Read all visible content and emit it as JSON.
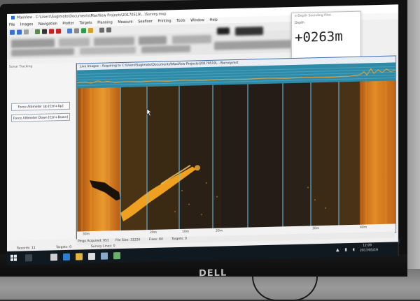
{
  "app": {
    "title": "MaxView - C:\\Users\\Sugimoto\\Documents\\MaxView Projects\\20170519\\...\\Survey.mxp",
    "menu": [
      "File",
      "Images",
      "Navigation",
      "Plotter",
      "Targets",
      "Planning",
      "Measure",
      "Seafloor",
      "Printing",
      "Tools",
      "Window",
      "Help"
    ]
  },
  "depth_window": {
    "title": "e-Depth Sounding Pilot",
    "subtitle": "Depth",
    "readout": "+0263m"
  },
  "left_panel": {
    "title": "Sonar Tracking",
    "buttons": [
      "Force Altimeter Up [Ctrl+Up]",
      "Force Altimeter Down [Ctrl+Down]"
    ]
  },
  "live_images": {
    "title": "Live Images - Acquiring to C:\\Users\\Sugimoto\\Documents\\MaxView Projects\\20170519\\...\\Survey.mst",
    "scale_labels": [
      "30m",
      "20m",
      "10m",
      "20m",
      "30m",
      "40m"
    ]
  },
  "status": {
    "pings": "Pings Acquired: 951",
    "file_size": "File Size: 31226",
    "fixes": "Fixes: 84",
    "targets": "Targets: 0"
  },
  "info": {
    "records": "Records: 11",
    "targets": "Targets: 0",
    "survey_lines": "Survey Lines: 0"
  },
  "taskbar": {
    "time": "12:09",
    "date": "2017/05/19"
  },
  "monitor": {
    "brand": "DELL"
  },
  "colors": {
    "sonar_dark": "#2a2418",
    "sonar_bright": "#f0a020",
    "graph_strip": "#2e8aa6",
    "taskbar": "#101820",
    "window_accent": "#3d6fb0"
  }
}
